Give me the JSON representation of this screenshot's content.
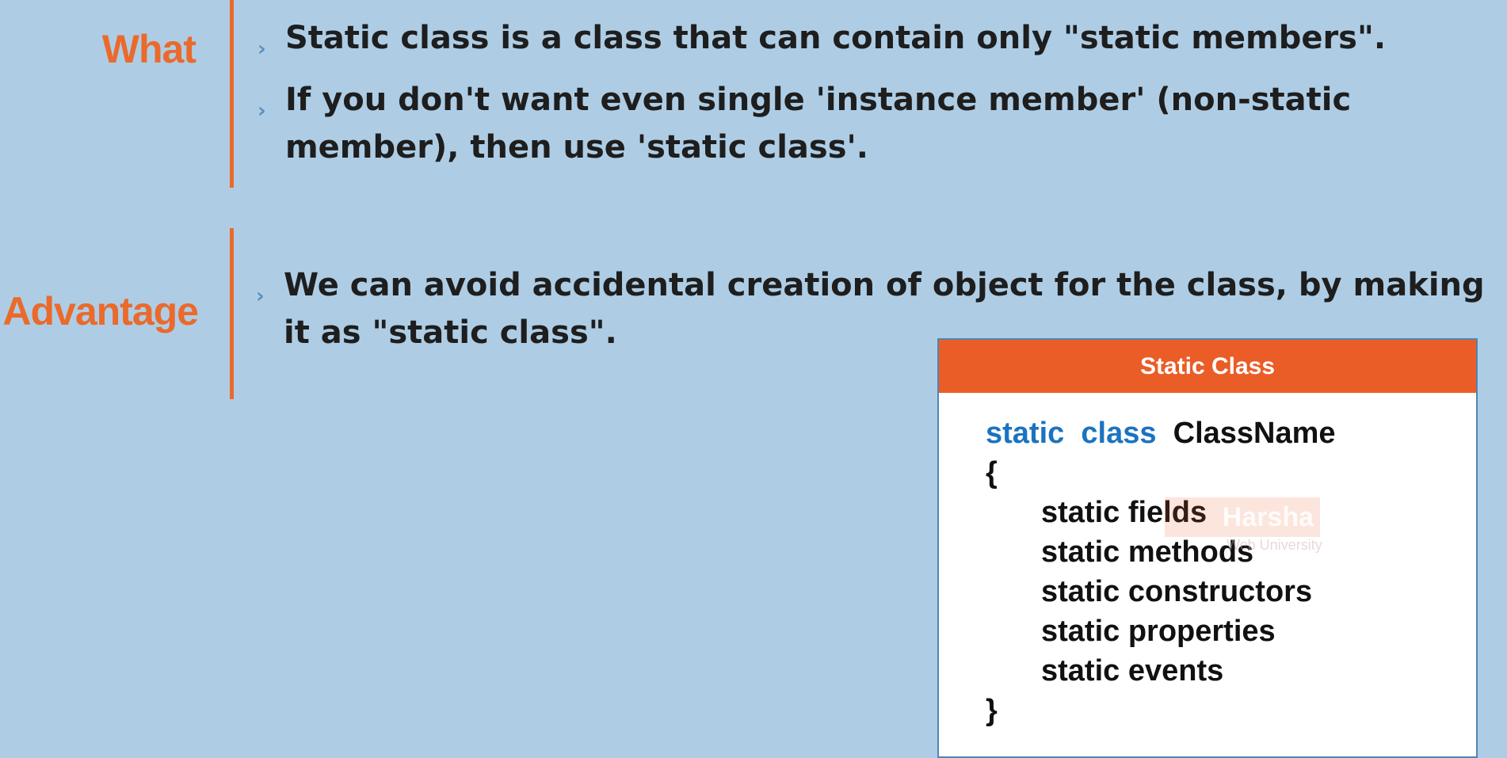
{
  "sections": {
    "what": {
      "label": "What",
      "points": [
        "Static class is a class that can contain only \"static members\".",
        "If you don't want even single 'instance member' (non-static member), then use 'static class'."
      ]
    },
    "advantage": {
      "label": "Advantage",
      "points": [
        "We can avoid accidental creation of object for the class, by making it as \"static class\"."
      ]
    }
  },
  "bullet_glyph": "›",
  "code_card": {
    "title": "Static Class",
    "keyword_static": "static",
    "keyword_class": "class",
    "class_name": "ClassName",
    "open_brace": "{",
    "members": [
      "static fields",
      "static methods",
      "static constructors",
      "static properties",
      "static events"
    ],
    "close_brace": "}"
  },
  "watermark": {
    "name": "Harsha",
    "subtitle": "Web University"
  },
  "colors": {
    "background": "#aecde5",
    "accent_orange": "#ea6a2c",
    "card_header": "#ea5d26",
    "keyword_blue": "#1b73c0",
    "bullet_blue": "#5a8fbf"
  }
}
